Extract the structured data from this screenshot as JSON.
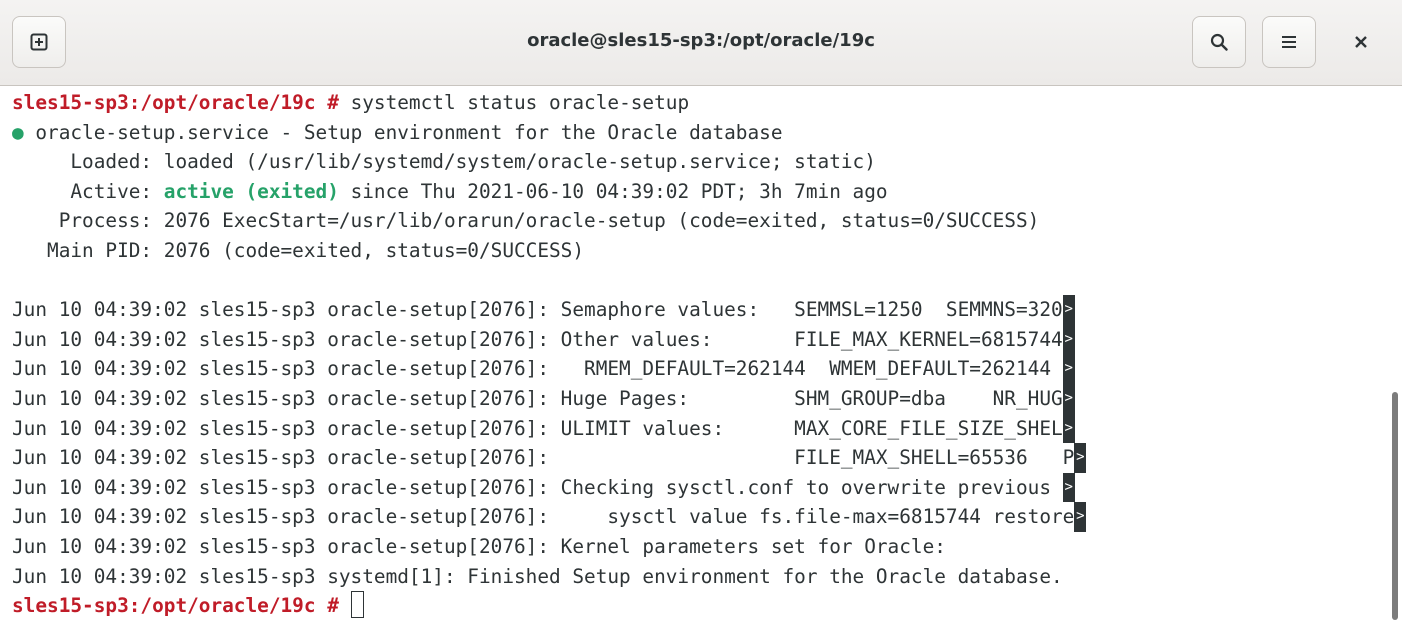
{
  "window": {
    "title": "oracle@sles15-sp3:/opt/oracle/19c"
  },
  "icons": {
    "new_tab": "new-tab-icon",
    "search": "search-icon",
    "menu": "hamburger-menu-icon",
    "close": "close-icon"
  },
  "colors": {
    "prompt": "#c01c28",
    "active_status": "#26a269",
    "text": "#2e3436"
  },
  "terminal": {
    "prompt": "sles15-sp3:/opt/oracle/19c #",
    "command": " systemctl status oracle-setup",
    "status_bullet": "●",
    "service_line": " oracle-setup.service - Setup environment for the Oracle database",
    "loaded_line": "     Loaded: loaded (/usr/lib/systemd/system/oracle-setup.service; static)",
    "active_prefix": "     Active: ",
    "active_state": "active (exited)",
    "active_suffix": " since Thu 2021-06-10 04:39:02 PDT; 3h 7min ago",
    "process_line": "    Process: 2076 ExecStart=/usr/lib/orarun/oracle-setup (code=exited, status=0/SUCCESS)",
    "mainpid_line": "   Main PID: 2076 (code=exited, status=0/SUCCESS)",
    "log_lines": [
      "Jun 10 04:39:02 sles15-sp3 oracle-setup[2076]: Semaphore values:   SEMMSL=1250  SEMMNS=320",
      "Jun 10 04:39:02 sles15-sp3 oracle-setup[2076]: Other values:       FILE_MAX_KERNEL=6815744",
      "Jun 10 04:39:02 sles15-sp3 oracle-setup[2076]:   RMEM_DEFAULT=262144  WMEM_DEFAULT=262144 ",
      "Jun 10 04:39:02 sles15-sp3 oracle-setup[2076]: Huge Pages:         SHM_GROUP=dba    NR_HUG",
      "Jun 10 04:39:02 sles15-sp3 oracle-setup[2076]: ULIMIT values:      MAX_CORE_FILE_SIZE_SHEL",
      "Jun 10 04:39:02 sles15-sp3 oracle-setup[2076]:                     FILE_MAX_SHELL=65536   P",
      "Jun 10 04:39:02 sles15-sp3 oracle-setup[2076]: Checking sysctl.conf to overwrite previous ",
      "Jun 10 04:39:02 sles15-sp3 oracle-setup[2076]:     sysctl value fs.file-max=6815744 restore"
    ],
    "final_lines": [
      "Jun 10 04:39:02 sles15-sp3 oracle-setup[2076]: Kernel parameters set for Oracle:",
      "Jun 10 04:39:02 sles15-sp3 systemd[1]: Finished Setup environment for the Oracle database."
    ],
    "truncation_marker": ">",
    "final_prompt": "sles15-sp3:/opt/oracle/19c #"
  }
}
